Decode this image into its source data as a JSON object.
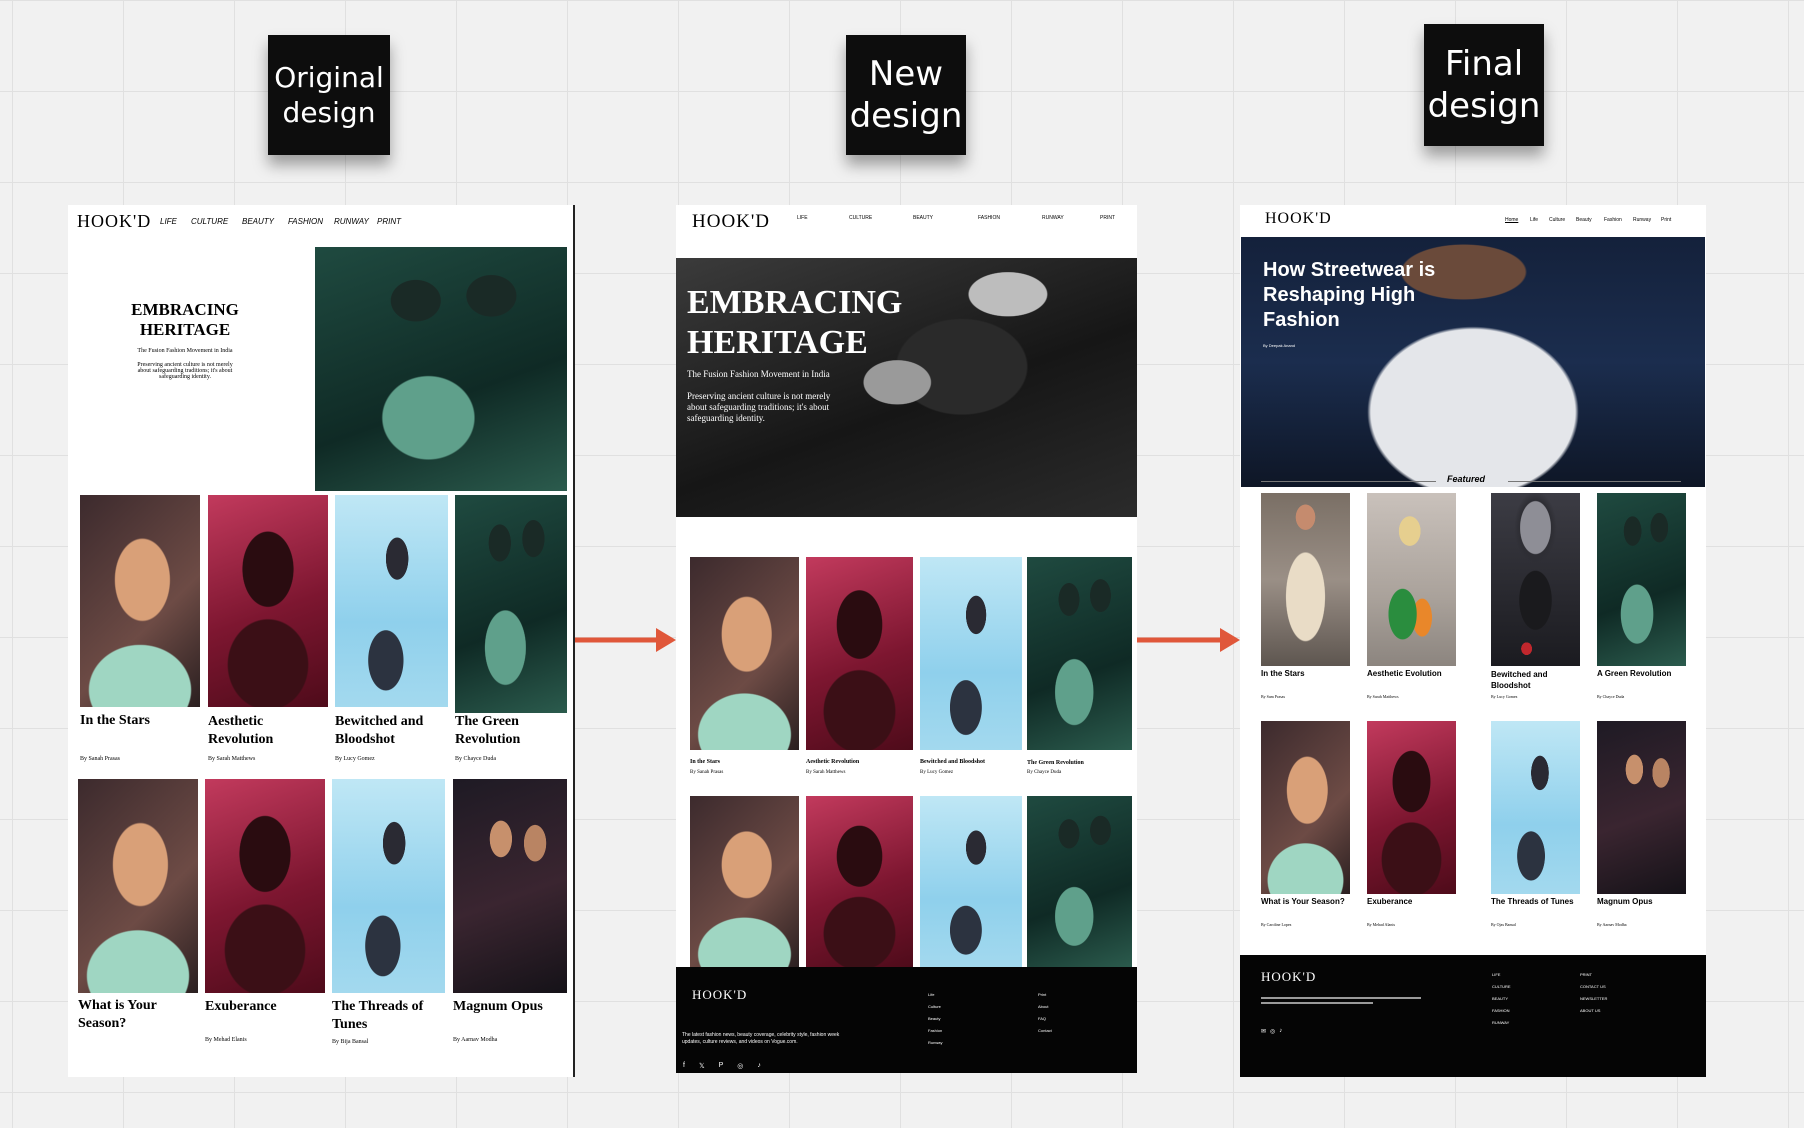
{
  "notes": {
    "original": "Original\ndesign",
    "new": "New\ndesign",
    "final": "Final\ndesign"
  },
  "colors": {
    "arrow": "#e0573a",
    "board_bg": "#ffffff",
    "footer_bg": "#050505"
  },
  "original": {
    "logo": "HOOK'D",
    "nav": [
      "LIFE",
      "CULTURE",
      "BEAUTY",
      "FASHION",
      "RUNWAY",
      "PRINT"
    ],
    "hero": {
      "title_l1": "EMBRACING",
      "title_l2": "HERITAGE",
      "subtitle": "The Fusion Fashion Movement in India",
      "desc_l1": "Preserving ancient culture is not merely",
      "desc_l2": "about safeguarding traditions; it's about",
      "desc_l3": "safeguarding identity."
    },
    "cards_row1": [
      {
        "t1": "In the Stars",
        "t2": "",
        "by": "By Sanah Prasas"
      },
      {
        "t1": "Aesthetic",
        "t2": "Revolution",
        "by": "By Sarah Matthews"
      },
      {
        "t1": "Bewitched and",
        "t2": "Bloodshot",
        "by": "By Lucy Gomez"
      },
      {
        "t1": "The Green",
        "t2": "Revolution",
        "by": "By Chayce Duda"
      }
    ],
    "cards_row2": [
      {
        "t1": "What is Your",
        "t2": "Season?",
        "by": ""
      },
      {
        "t1": "Exuberance",
        "t2": "",
        "by": "By Mehad Elanis"
      },
      {
        "t1": "The Threads of",
        "t2": "Tunes",
        "by": "By Bija Bansal"
      },
      {
        "t1": "Magnum Opus",
        "t2": "",
        "by": "By Aarnav Modha"
      }
    ]
  },
  "new": {
    "logo": "HOOK'D",
    "nav": [
      "LIFE",
      "CULTURE",
      "BEAUTY",
      "FASHION",
      "RUNWAY",
      "PRINT"
    ],
    "hero": {
      "title_l1": "EMBRACING",
      "title_l2": "HERITAGE",
      "subtitle": "The Fusion Fashion Movement in India",
      "desc_l1": "Preserving ancient culture is not merely",
      "desc_l2": "about safeguarding traditions; it's about",
      "desc_l3": "safeguarding identity."
    },
    "cards": [
      {
        "t": "In the Stars",
        "by": "By Sanah Prasas"
      },
      {
        "t": "Aesthetic Revolution",
        "by": "By Sarah Matthews"
      },
      {
        "t": "Bewitched and Bloodshot",
        "by": "By Lucy Gomez"
      },
      {
        "t": "The Green Revolution",
        "by": "By Chayce Duda"
      }
    ],
    "footer": {
      "logo": "HOOK'D",
      "tagline_l1": "The latest fashion news, beauty coverage, celebrity style, fashion week",
      "tagline_l2": "updates, culture reviews, and videos on Vogue.com.",
      "col1": [
        "Life",
        "Culture",
        "Beauty",
        "Fashion",
        "Runway"
      ],
      "col2": [
        "Print",
        "About",
        "FAQ",
        "Contact"
      ]
    }
  },
  "final": {
    "logo": "HOOK'D",
    "nav": [
      "Home",
      "Life",
      "Culture",
      "Beauty",
      "Fashion",
      "Runway",
      "Print"
    ],
    "hero": {
      "title_l1": "How Streetwear is",
      "title_l2": "Reshaping High",
      "title_l3": "Fashion",
      "byline": "By Deepak Anand"
    },
    "featured": "Featured",
    "cards_row1": [
      {
        "t1": "In the Stars",
        "t2": "",
        "by": "By Sam Prasas"
      },
      {
        "t1": "Aesthetic Evolution",
        "t2": "",
        "by": "By Sarah Matthews"
      },
      {
        "t1": "Bewitched and",
        "t2": "Bloodshot",
        "by": "By Lucy Gomez"
      },
      {
        "t1": "A Green Revolution",
        "t2": "",
        "by": "By Chayce Duda"
      }
    ],
    "cards_row2": [
      {
        "t1": "What is Your Season?",
        "by": "By Caroline Lopez"
      },
      {
        "t1": "Exuberance",
        "by": "By Mehad Alanis"
      },
      {
        "t1": "The Threads of Tunes",
        "by": "By Ojas Bansal"
      },
      {
        "t1": "Magnum Opus",
        "by": "By Aarnav Modha"
      }
    ],
    "footer": {
      "logo": "HOOK'D",
      "col1": [
        "LIFE",
        "CULTURE",
        "BEAUTY",
        "FASHION",
        "RUNWAY"
      ],
      "col2": [
        "PRINT",
        "CONTACT US",
        "NEWSLETTER",
        "ABOUT US"
      ]
    }
  }
}
